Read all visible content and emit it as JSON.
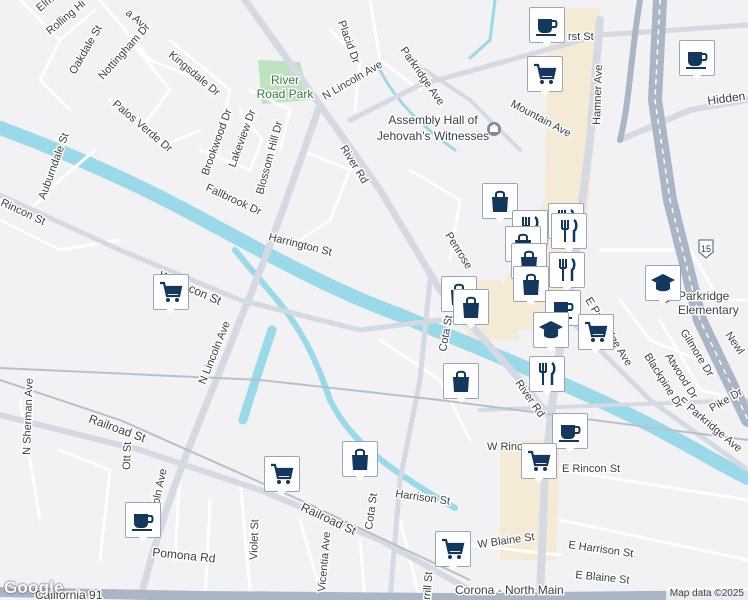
{
  "map": {
    "attribution": "Map data ©2025",
    "logo": "Google",
    "colors": {
      "background": "#f2f1f4",
      "water": "#9ad9e8",
      "road": "#ffffff",
      "major_road": "#d5dae2",
      "freeway": "#aab5c6",
      "park": "#bfe3bf",
      "commercial": "#f4ead6",
      "pin_icon": "#14375e"
    }
  },
  "places": {
    "river_road_park": "River Road Park",
    "assembly_hall": "Assembly Hall of Jehovah's Witnesses",
    "parkridge_elementary": "Parkridge Elementary",
    "corona_north_main": "Corona - North Main"
  },
  "streets": {
    "elm": "Elm",
    "rolling_hills": "Rolling Hi",
    "ave_top": "a Ave",
    "oakdale": "Oakdale St",
    "nottingham": "Nottingham Dr",
    "kingsdale": "Kingsdale Dr",
    "palos_verde": "Palos Verde Dr",
    "auburndale": "Auburndale St",
    "rincon_w": "Rincon St",
    "brookwood": "Brookwood Dr",
    "lakeview": "Lakeview Dr",
    "blossom_hill": "Blossom Hill Dr",
    "fallbrook": "Fallbrook Dr",
    "placid": "Placid Dr",
    "n_lincoln_top": "N Lincoln Ave",
    "river_rd_top": "River Rd",
    "parkridge_ave": "Parkridge Ave",
    "mountain_ave": "Mountain Ave",
    "hamner": "Hamner Ave",
    "hidden": "Hidden",
    "first_st": "rst St",
    "harrington": "Harrington St",
    "w_rincon_mid": "W Rincon St",
    "n_lincoln_mid": "N Lincoln Ave",
    "penrose": "Penrose",
    "cota_st_mid": "Cota St",
    "river_rd_mid": "River Rd",
    "e_parkridge_ave": "E Parkridge Ave",
    "e_parkridge_ave2": "E Parkridge Ave",
    "gilmore": "Gilmore Dr",
    "atwood": "Atwood Dr",
    "blackpine": "Blackpine Dr",
    "pike": "Pike Dr",
    "newl": "Newl",
    "n_sherman": "N Sherman Ave",
    "ott": "Ott St",
    "lincoln_ave_low": "coln Ave",
    "railroad_w": "Railroad St",
    "railroad_mid": "Railroad St",
    "w_rincon_low": "W Rinc",
    "e_rincon": "E Rincon St",
    "harrison": "Harrison St",
    "cota_low": "Cota St",
    "violet": "Violet St",
    "vicentia": "Vicentia Ave",
    "pomona": "Pomona Rd",
    "w_blaine": "W Blaine St",
    "e_harrison": "E Harrison St",
    "e_blaine": "E Blaine St",
    "merrill": "rrill St",
    "ca91": "California 91",
    "i15": "15"
  },
  "pins": [
    {
      "icon": "cafe-icon",
      "type": "cafe"
    },
    {
      "icon": "shopping-cart-icon",
      "type": "grocery"
    },
    {
      "icon": "cafe-icon",
      "type": "cafe"
    },
    {
      "icon": "shopping-bag-icon",
      "type": "store"
    },
    {
      "icon": "restaurant-icon",
      "type": "restaurant"
    },
    {
      "icon": "restaurant-icon",
      "type": "restaurant"
    },
    {
      "icon": "restaurant-icon",
      "type": "restaurant"
    },
    {
      "icon": "shopping-bag-icon",
      "type": "store"
    },
    {
      "icon": "restaurant-icon",
      "type": "restaurant"
    },
    {
      "icon": "shopping-bag-icon",
      "type": "store"
    },
    {
      "icon": "shopping-bag-icon",
      "type": "store"
    },
    {
      "icon": "shopping-bag-icon",
      "type": "store"
    },
    {
      "icon": "cafe-icon",
      "type": "cafe"
    },
    {
      "icon": "graduation-cap-icon",
      "type": "school"
    },
    {
      "icon": "school-icon",
      "type": "school"
    },
    {
      "icon": "shopping-cart-icon",
      "type": "grocery"
    },
    {
      "icon": "shopping-cart-icon",
      "type": "grocery"
    },
    {
      "icon": "restaurant-icon",
      "type": "restaurant"
    },
    {
      "icon": "shopping-bag-icon",
      "type": "store"
    },
    {
      "icon": "cafe-icon",
      "type": "cafe"
    },
    {
      "icon": "shopping-cart-icon",
      "type": "grocery"
    },
    {
      "icon": "shopping-bag-icon",
      "type": "store"
    },
    {
      "icon": "shopping-cart-icon",
      "type": "grocery"
    },
    {
      "icon": "cafe-icon",
      "type": "cafe"
    },
    {
      "icon": "shopping-cart-icon",
      "type": "grocery"
    }
  ]
}
